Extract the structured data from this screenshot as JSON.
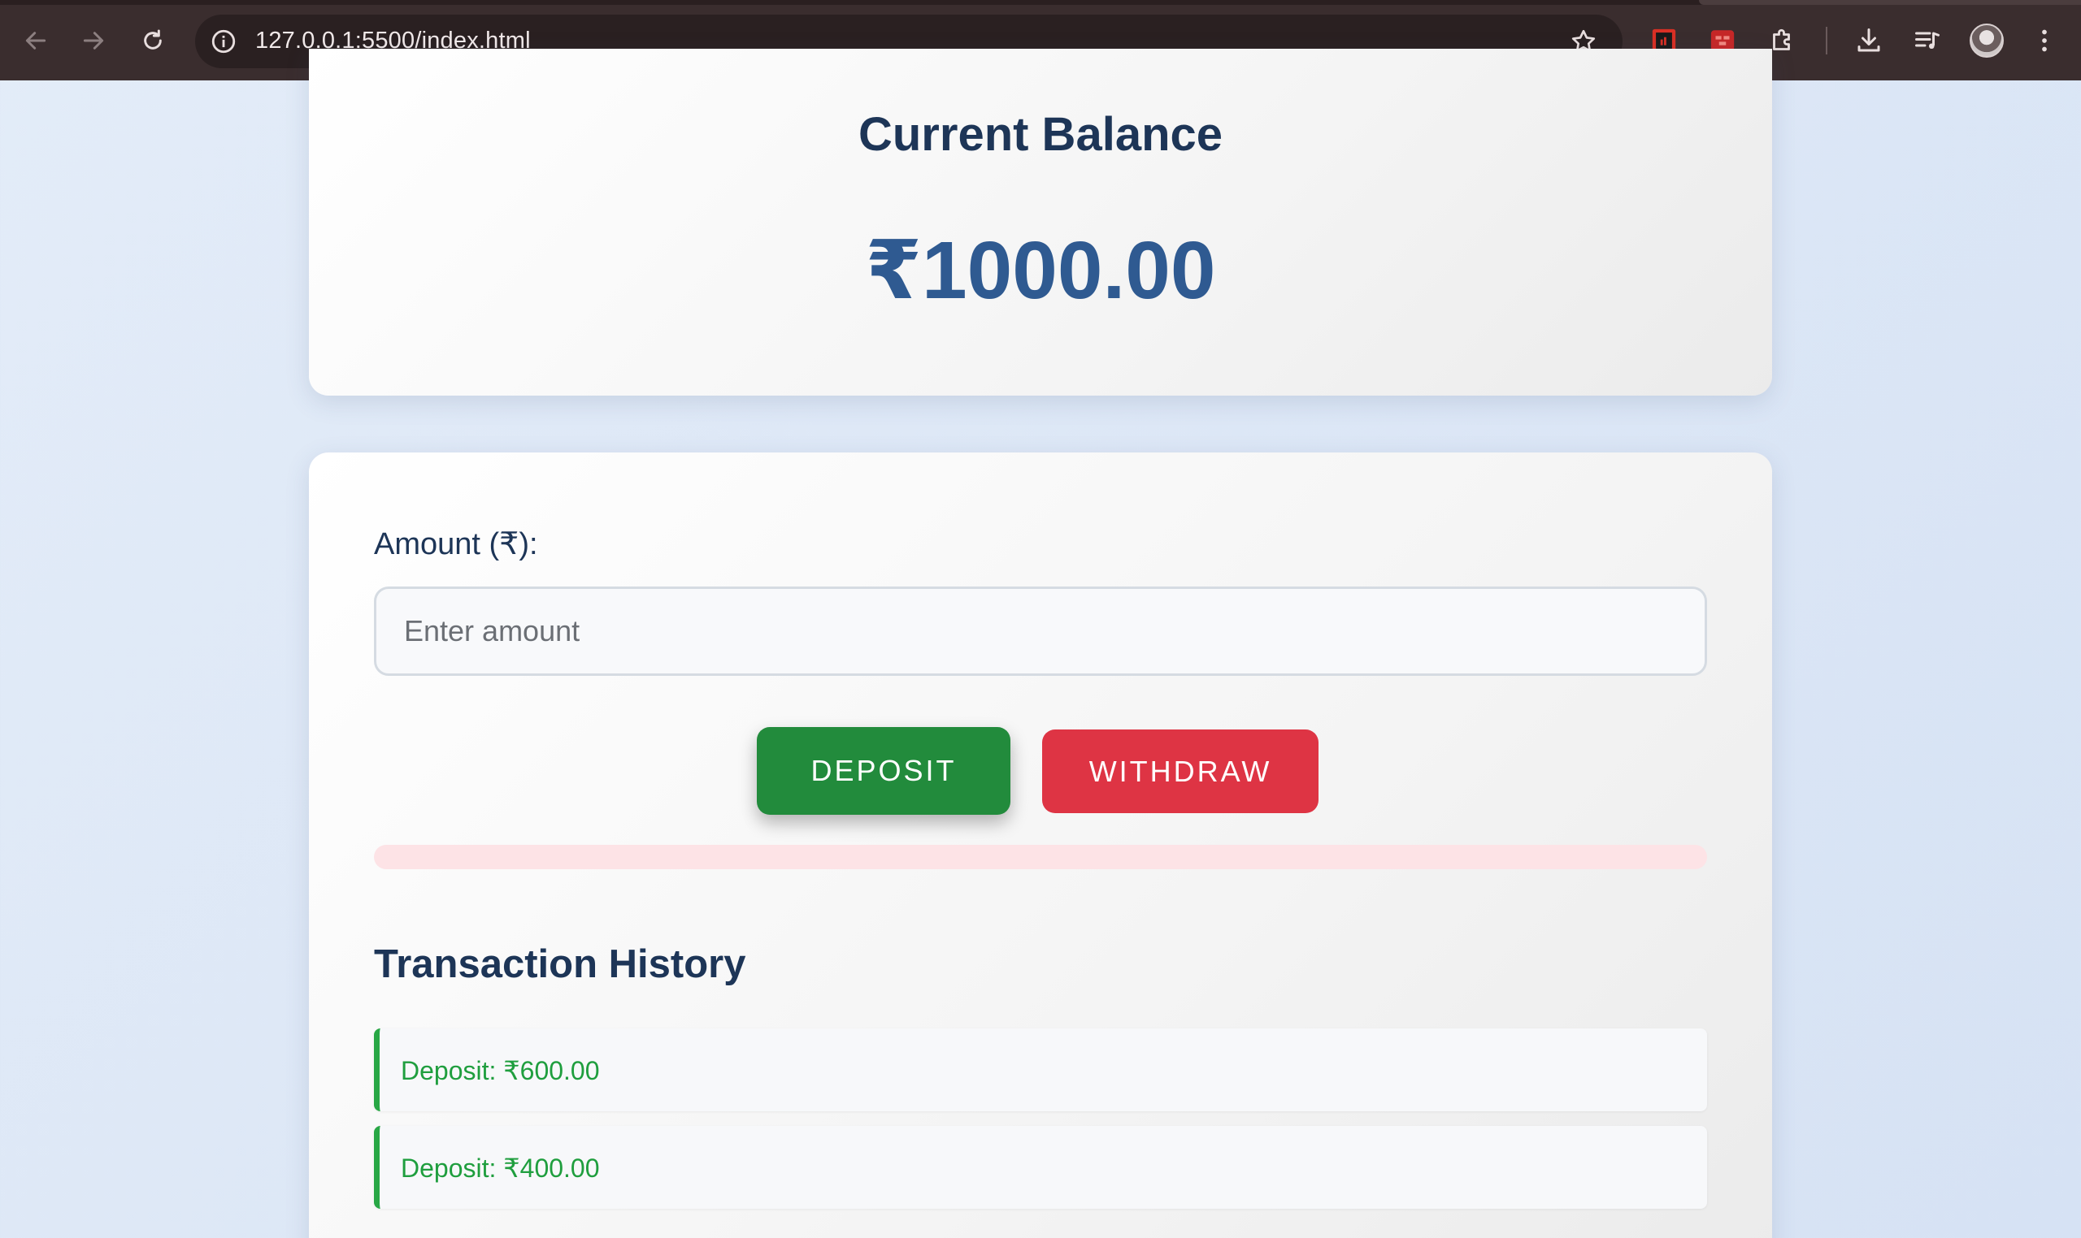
{
  "browser": {
    "url": "127.0.0.1:5500/index.html",
    "icons": [
      "back-arrow-icon",
      "forward-arrow-icon",
      "reload-icon",
      "site-info-icon",
      "bookmark-star-icon",
      "extension-icon",
      "extensions-puzzle-icon",
      "download-icon",
      "media-playlist-icon",
      "profile-avatar-icon",
      "more-menu-icon"
    ]
  },
  "balance": {
    "title": "Current Balance",
    "amount": "₹1000.00"
  },
  "form": {
    "amount_label": "Amount (₹):",
    "amount_placeholder": "Enter amount",
    "amount_value": "",
    "deposit_label": "DEPOSIT",
    "withdraw_label": "WITHDRAW",
    "message": ""
  },
  "history": {
    "title": "Transaction History",
    "items": [
      {
        "text": "Deposit: ₹600.00",
        "type": "deposit"
      },
      {
        "text": "Deposit: ₹400.00",
        "type": "deposit"
      }
    ]
  },
  "colors": {
    "heading": "#1d3557",
    "balance": "#2f5a91",
    "deposit": "#228b3c",
    "withdraw": "#de3444",
    "deposit_text": "#1f9e3e",
    "message_bg": "#fde3e6"
  }
}
